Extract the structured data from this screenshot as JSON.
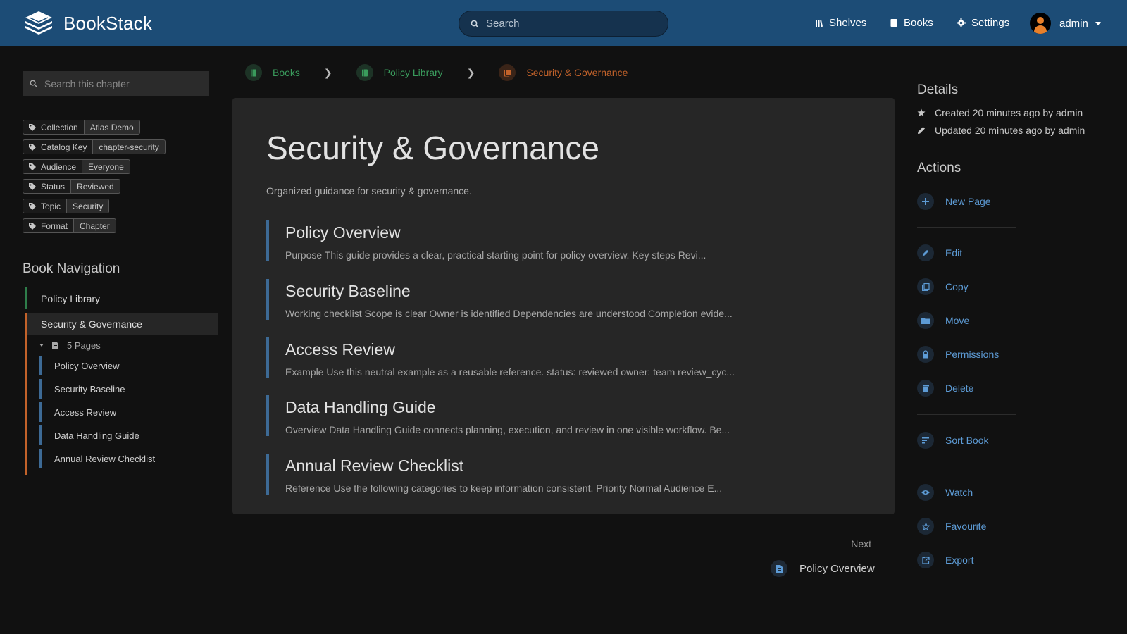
{
  "app": {
    "name": "BookStack"
  },
  "header": {
    "search_placeholder": "Search",
    "nav": {
      "shelves": "Shelves",
      "books": "Books",
      "settings": "Settings"
    },
    "user": {
      "name": "admin"
    }
  },
  "sidebar": {
    "search_placeholder": "Search this chapter",
    "tags": [
      {
        "name": "Collection",
        "value": "Atlas Demo"
      },
      {
        "name": "Catalog Key",
        "value": "chapter-security"
      },
      {
        "name": "Audience",
        "value": "Everyone"
      },
      {
        "name": "Status",
        "value": "Reviewed"
      },
      {
        "name": "Topic",
        "value": "Security"
      },
      {
        "name": "Format",
        "value": "Chapter"
      }
    ],
    "book_nav_title": "Book Navigation",
    "book_name": "Policy Library",
    "chapter_name": "Security & Governance",
    "pages_toggle": "5 Pages",
    "pages": [
      "Policy Overview",
      "Security Baseline",
      "Access Review",
      "Data Handling Guide",
      "Annual Review Checklist"
    ]
  },
  "breadcrumbs": [
    "Books",
    "Policy Library",
    "Security & Governance"
  ],
  "chapter": {
    "title": "Security & Governance",
    "description": "Organized guidance for security & governance.",
    "pages": [
      {
        "title": "Policy Overview",
        "excerpt": "Purpose This guide provides a clear, practical starting point for policy overview. Key steps Revi..."
      },
      {
        "title": "Security Baseline",
        "excerpt": "Working checklist Scope is clear Owner is identified Dependencies are understood Completion evide..."
      },
      {
        "title": "Access Review",
        "excerpt": "Example Use this neutral example as a reusable reference. status: reviewed owner: team review_cyc..."
      },
      {
        "title": "Data Handling Guide",
        "excerpt": "Overview Data Handling Guide connects planning, execution, and review in one visible workflow. Be..."
      },
      {
        "title": "Annual Review Checklist",
        "excerpt": "Reference Use the following categories to keep information consistent. Priority Normal Audience E..."
      }
    ]
  },
  "next": {
    "label": "Next",
    "title": "Policy Overview"
  },
  "details": {
    "title": "Details",
    "created": "Created 20 minutes ago by admin",
    "updated": "Updated 20 minutes ago by admin"
  },
  "actions": {
    "title": "Actions",
    "new_page": "New Page",
    "edit": "Edit",
    "copy": "Copy",
    "move": "Move",
    "permissions": "Permissions",
    "delete": "Delete",
    "sort_book": "Sort Book",
    "watch": "Watch",
    "favourite": "Favourite",
    "export": "Export"
  },
  "colors": {
    "header": "#1c4c76",
    "book": "#2e7d4a",
    "chapter": "#c2622a",
    "page": "#3d6a95",
    "link": "#5d9bd5"
  }
}
